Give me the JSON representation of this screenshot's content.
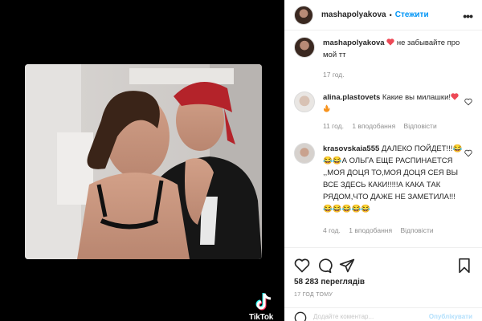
{
  "post": {
    "username": "mashapolyakova",
    "follow_label": "Стежити",
    "separator": "•",
    "more_icon": "more-horizontal-icon"
  },
  "caption": {
    "username": "mashapolyakova",
    "text": "не забывайте про мой тт",
    "time": "17 год."
  },
  "comments": [
    {
      "username": "alina.plastovets",
      "text": "Какие вы милашки!",
      "time": "11 год.",
      "likes": "1 вподобання",
      "reply": "Відповісти"
    },
    {
      "username": "krasovskaia555",
      "text": "ДАЛЕКО ПОЙДЕТ!!!😂😂😂А ОЛЬГА ЕЩЕ РАСПИНАЕТСЯ ,,МОЯ ДОЦЯ ТО,МОЯ ДОЦЯ СЕЯ ВЫ ВСЕ ЗДЕСЬ КАКИ!!!!!А КАКА ТАК РЯДОМ,ЧТО ДАЖЕ НЕ ЗАМЕТИЛА!!!😂😂😂😂😂",
      "time": "4 год.",
      "likes": "1 вподобання",
      "reply": "Відповісти"
    }
  ],
  "stats": {
    "views": "58 283 переглядів",
    "posted": "17 ГОД ТОМУ"
  },
  "comment_box": {
    "placeholder": "Додайте коментар...",
    "publish_label": "Опублікувати"
  },
  "watermark": {
    "text": "TikTok"
  },
  "colors": {
    "accent": "#0095f6",
    "heart": "#ed4956",
    "muted": "#8e8e8e"
  }
}
